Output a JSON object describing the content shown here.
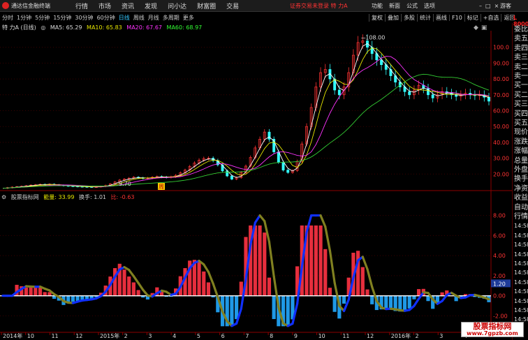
{
  "app": {
    "title": "通达信金融终端"
  },
  "menu": [
    {
      "label": "行情"
    },
    {
      "label": "市场"
    },
    {
      "label": "资讯"
    },
    {
      "label": "发现"
    },
    {
      "label": "问小达"
    },
    {
      "label": "财富圈"
    },
    {
      "label": "交易"
    }
  ],
  "login_status": "证券交易未登录  特 力A",
  "menu_right": [
    {
      "label": "功能"
    },
    {
      "label": "新面"
    },
    {
      "label": "公式"
    },
    {
      "label": "选项"
    }
  ],
  "window_buttons": [
    "–",
    "□",
    "×"
  ],
  "guest": "游客",
  "periods": [
    {
      "label": "分时"
    },
    {
      "label": "1分钟"
    },
    {
      "label": "5分钟"
    },
    {
      "label": "15分钟"
    },
    {
      "label": "30分钟"
    },
    {
      "label": "60分钟"
    },
    {
      "label": "日线",
      "active": true
    },
    {
      "label": "周线"
    },
    {
      "label": "月线"
    },
    {
      "label": "多周期"
    },
    {
      "label": "更多"
    }
  ],
  "toolbar": [
    {
      "label": "复权"
    },
    {
      "label": "叠加"
    },
    {
      "label": "多股"
    },
    {
      "label": "统计"
    },
    {
      "label": "画线"
    },
    {
      "label": "F10"
    },
    {
      "label": "标记"
    },
    {
      "label": "+自选"
    },
    {
      "label": "返回"
    }
  ],
  "stock": {
    "name": "特 力A (日线)",
    "ma5": "MA5: 65.29",
    "ma10": "MA10: 65.83",
    "ma20": "MA20: 67.67",
    "ma60": "MA60: 68.97"
  },
  "side_logo": "L 8000",
  "side_items": [
    "委比",
    "卖五",
    "卖四",
    "卖三",
    "卖二",
    "卖一",
    "买一",
    "买二",
    "买三",
    "买四",
    "买五",
    "现价",
    "涨跌",
    "涨幅",
    "总量",
    "外盘",
    "换手",
    "净资",
    "收益",
    "自动",
    "行情",
    "14:58",
    "14:58",
    "14:58",
    "14:58",
    "14:58",
    "14:58",
    "14:58",
    "14:58",
    "14:58",
    "14:58",
    "14:58"
  ],
  "indicator": {
    "name": "股票指标网",
    "vol": "能量: 33.99",
    "turnover": "换手: 1.01",
    "lb": "比: -0.63"
  },
  "chart_data": {
    "type": "line",
    "price_ylim": [
      10,
      110
    ],
    "price_ticks": [
      "100.0",
      "90.00",
      "80.00",
      "70.00",
      "60.00",
      "50.00",
      "40.00",
      "30.00",
      "20.00"
    ],
    "price_tick_values": [
      100,
      90,
      80,
      70,
      60,
      50,
      40,
      30,
      20
    ],
    "annotations": {
      "high": "108.00",
      "low": "9.70",
      "low_marker": "周"
    },
    "indicator_ylim": [
      -3.5,
      9.5
    ],
    "indicator_ticks": [
      "8.00",
      "6.00",
      "4.00",
      "2.00",
      "0.00",
      "-2.00"
    ],
    "indicator_tick_values": [
      8,
      6,
      4,
      2,
      0,
      -2
    ],
    "indicator_current": "1.20",
    "x_labels": [
      "2014年",
      "10",
      "11",
      "12",
      "2015年",
      "2",
      "3",
      "4",
      "5",
      "6",
      "7",
      "8",
      "9",
      "10",
      "11",
      "12",
      "2016年",
      "2",
      "3",
      "4"
    ],
    "close_series": [
      11,
      11.4,
      11.8,
      12,
      12.3,
      12.6,
      13,
      13.2,
      13.5,
      13.4,
      13.6,
      13.2,
      12.9,
      12.6,
      12.4,
      12.3,
      12.1,
      12,
      11.9,
      11.8,
      11.9,
      12.2,
      12.8,
      13.8,
      15,
      16.2,
      16.8,
      17.4,
      18,
      17.6,
      17.2,
      17.5,
      18,
      18.4,
      18.1,
      17.9,
      18.3,
      19.2,
      20.8,
      22.5,
      24.8,
      27,
      28.8,
      29.8,
      30,
      28.5,
      25.8,
      22,
      18.8,
      16.8,
      17.8,
      21,
      25,
      30.5,
      36.5,
      42,
      46.5,
      42,
      34,
      27.5,
      22.5,
      21,
      22.2,
      28,
      39,
      50,
      62,
      75,
      84,
      86,
      80,
      73,
      70,
      75,
      84,
      95,
      103,
      104,
      100,
      96,
      92,
      89,
      86,
      82,
      78,
      75,
      72,
      70,
      73,
      76,
      74,
      70,
      68,
      70,
      72,
      71,
      70,
      69,
      70,
      71,
      70,
      69.5,
      70,
      68.5,
      66
    ]
  }
}
